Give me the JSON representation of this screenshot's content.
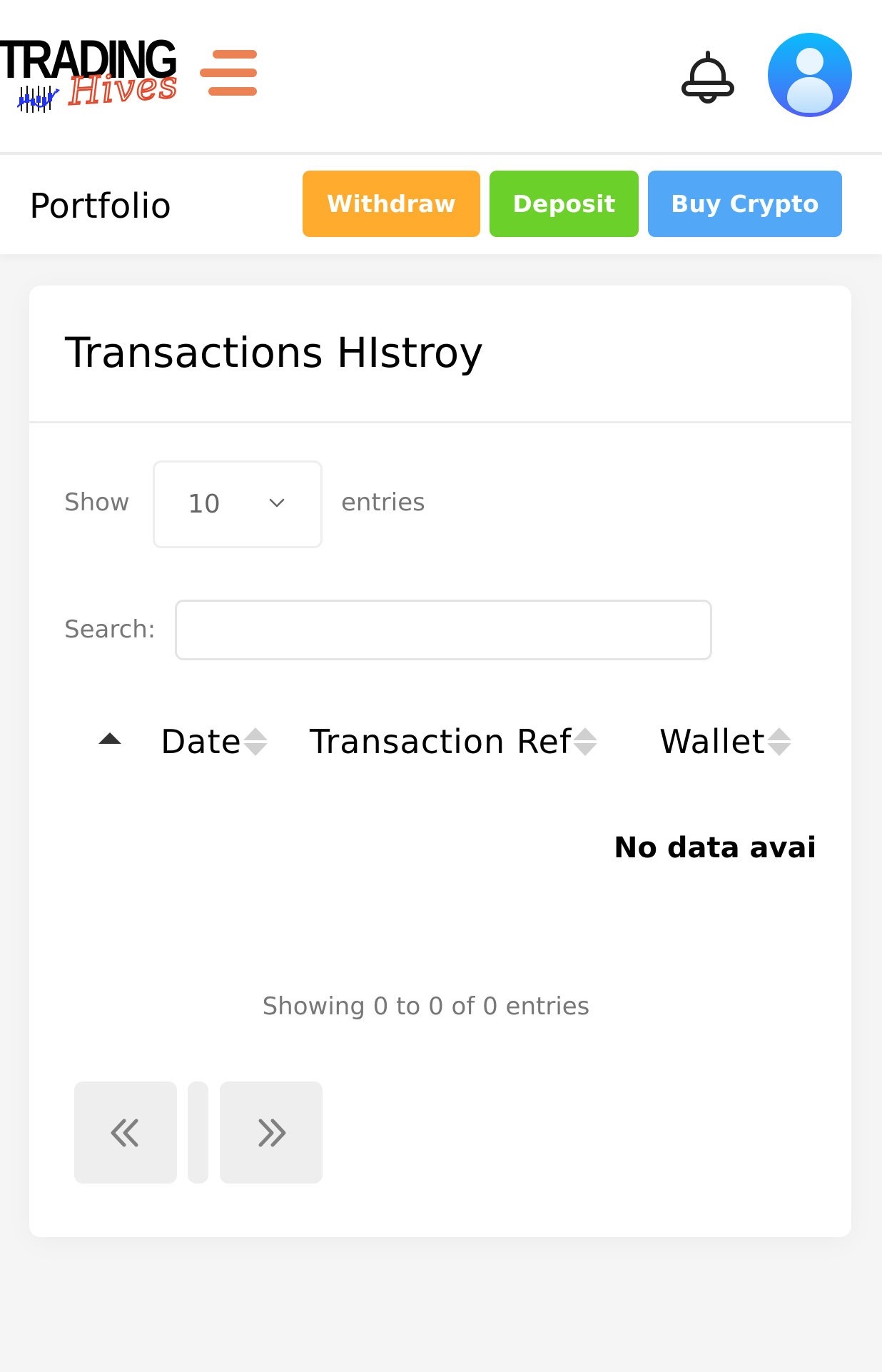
{
  "header": {
    "logo": {
      "word": "TRADING",
      "script": "Hives",
      "alt": "Trading Hives logo"
    },
    "menu_icon": "hamburger-icon",
    "notification_icon": "bell-icon",
    "avatar_icon": "user-avatar-icon",
    "colors": {
      "menu": "#ec8253",
      "avatar_top": "#09bbfb",
      "avatar_bottom": "#5061f7"
    }
  },
  "nav": {
    "title": "Portfolio",
    "buttons": [
      {
        "label": "Withdraw",
        "color": "#ffab2e"
      },
      {
        "label": "Deposit",
        "color": "#6bd12a"
      },
      {
        "label": "Buy Crypto",
        "color": "#52a7f6"
      }
    ]
  },
  "card": {
    "title": "Transactions HIstroy",
    "length_menu": {
      "prefix": "Show",
      "selected": "10",
      "suffix": "entries"
    },
    "search": {
      "label": "Search:",
      "value": "",
      "placeholder": ""
    },
    "table": {
      "columns": [
        {
          "label": "",
          "sort": "asc"
        },
        {
          "label": "Date",
          "sort": "none"
        },
        {
          "label": "Transaction Ref",
          "sort": "none"
        },
        {
          "label": "Wallet",
          "sort": "none"
        }
      ],
      "rows": [],
      "empty_message": "No data available in table"
    },
    "info": "Showing 0 to 0 of 0 entries",
    "pagination": {
      "previous_icon": "double-chevron-left-icon",
      "next_icon": "double-chevron-right-icon",
      "pages": []
    }
  }
}
